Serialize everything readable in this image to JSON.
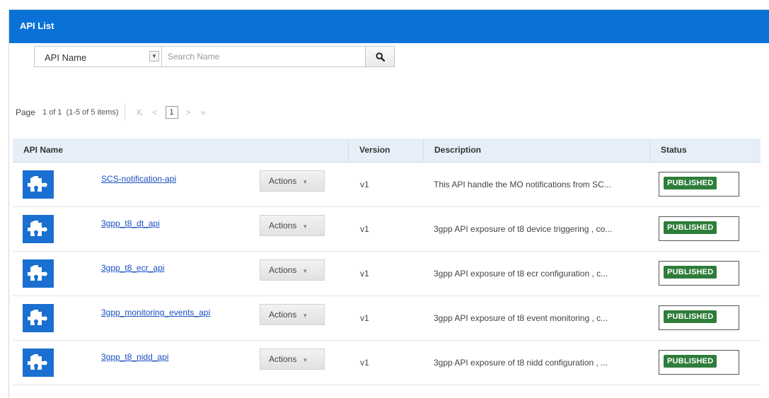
{
  "header": {
    "title": "API List"
  },
  "search": {
    "field_selected": "API Name",
    "placeholder": "Search Name",
    "value": ""
  },
  "pagination": {
    "page_label": "Page",
    "page_of": "1 of 1",
    "items": "(1-5 of 5 items)",
    "current_page": "1",
    "first": "K",
    "prev": "<",
    "next": ">",
    "last": "»"
  },
  "table": {
    "columns": [
      "API Name",
      "Version",
      "Description",
      "Status"
    ],
    "actions_label": "Actions",
    "rows": [
      {
        "name": "SCS-notification-api",
        "version": "v1",
        "description": "This API handle the MO notifications from SC...",
        "status": "PUBLISHED"
      },
      {
        "name": "3gpp_t8_dt_api",
        "version": "v1",
        "description": "3gpp API exposure of t8 device triggering , co...",
        "status": "PUBLISHED"
      },
      {
        "name": "3gpp_t8_ecr_api",
        "version": "v1",
        "description": "3gpp API exposure of t8 ecr configuration , c...",
        "status": "PUBLISHED"
      },
      {
        "name": "3gpp_monitoring_events_api",
        "version": "v1",
        "description": "3gpp API exposure of t8 event monitoring , c...",
        "status": "PUBLISHED"
      },
      {
        "name": "3gpp_t8_nidd_api",
        "version": "v1",
        "description": "3gpp API exposure of t8 nidd configuration , ...",
        "status": "PUBLISHED"
      }
    ]
  },
  "colors": {
    "header_bg": "#0a72d6",
    "icon_bg": "#1a6fd0",
    "status_published": "#2e7d3a",
    "link": "#1a4ec2"
  },
  "icons": {
    "search": "magnifier-icon",
    "api": "puzzle-icon",
    "dropdown": "chevron-down-icon"
  }
}
